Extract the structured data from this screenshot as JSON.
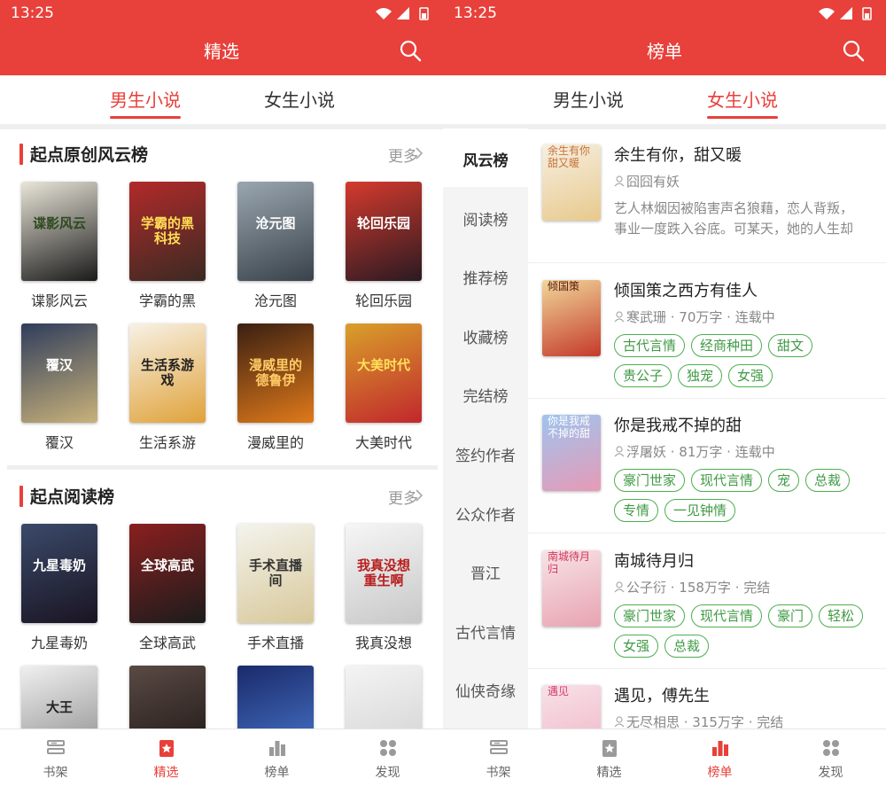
{
  "status": {
    "time": "13:25"
  },
  "left": {
    "title": "精选",
    "tabs": [
      "男生小说",
      "女生小说"
    ],
    "active_tab": 0,
    "sections": [
      {
        "title": "起点原创风云榜",
        "more": "更多",
        "books": [
          {
            "name": "谍影风云",
            "cover_text": "谍影风云",
            "colors": [
              "#e9e5d8",
              "#1a1a1a"
            ],
            "text_color": "#2d4a1f"
          },
          {
            "name": "学霸的黑",
            "cover_text": "学霸的黑科技",
            "colors": [
              "#b22a2a",
              "#3a2a22"
            ],
            "text_color": "#ffdd55"
          },
          {
            "name": "沧元图",
            "cover_text": "沧元图",
            "colors": [
              "#9aa6b0",
              "#39424a"
            ],
            "text_color": "#ffffff"
          },
          {
            "name": "轮回乐园",
            "cover_text": "轮回乐园",
            "colors": [
              "#d53a2d",
              "#2a1a22"
            ],
            "text_color": "#ffffff"
          }
        ]
      },
      {
        "title": "起点阅读榜",
        "more": "更多",
        "books": [
          {
            "name": "九星毒奶",
            "cover_text": "九星毒奶",
            "colors": [
              "#3a4a6a",
              "#1a1422"
            ],
            "text_color": "#ffffff"
          },
          {
            "name": "全球高武",
            "cover_text": "全球高武",
            "colors": [
              "#8a1f1f",
              "#1c1c1c"
            ],
            "text_color": "#ffffff"
          },
          {
            "name": "手术直播",
            "cover_text": "手术直播间",
            "colors": [
              "#f4f4ee",
              "#d8c89a"
            ],
            "text_color": "#333333"
          },
          {
            "name": "我真没想",
            "cover_text": "我真没想重生啊",
            "colors": [
              "#f6f6f6",
              "#c8c8c8"
            ],
            "text_color": "#b81d1d"
          }
        ]
      }
    ],
    "grid2_books": [
      {
        "name": "覆汉",
        "cover_text": "覆汉",
        "colors": [
          "#2f3d5c",
          "#c9b27a"
        ],
        "text_color": "#ffffff"
      },
      {
        "name": "生活系游",
        "cover_text": "生活系游戏",
        "colors": [
          "#f7f2e6",
          "#e0a23a"
        ],
        "text_color": "#222222"
      },
      {
        "name": "漫威里的",
        "cover_text": "漫威里的德鲁伊",
        "colors": [
          "#3a1f12",
          "#e07a1a"
        ],
        "text_color": "#ffcc66"
      },
      {
        "name": "大美时代",
        "cover_text": "大美时代",
        "colors": [
          "#d9a02a",
          "#c1272d"
        ],
        "text_color": "#ffe05a"
      }
    ],
    "partial_books": [
      {
        "cover_text": "大王",
        "colors": [
          "#f0f0f0",
          "#888888"
        ],
        "text_color": "#222222"
      },
      {
        "cover_text": "",
        "colors": [
          "#5a4a44",
          "#1a1414"
        ],
        "text_color": "#ffffff"
      },
      {
        "cover_text": "",
        "colors": [
          "#1a2a6a",
          "#4a7ad0"
        ],
        "text_color": "#ffffff"
      },
      {
        "cover_text": "",
        "colors": [
          "#f4f4f4",
          "#d0d0d0"
        ],
        "text_color": "#333333"
      }
    ]
  },
  "right": {
    "title": "榜单",
    "tabs": [
      "男生小说",
      "女生小说"
    ],
    "active_tab": 1,
    "rank_categories": [
      "风云榜",
      "阅读榜",
      "推荐榜",
      "收藏榜",
      "完结榜",
      "签约作者",
      "公众作者",
      "晋江",
      "古代言情",
      "仙侠奇缘"
    ],
    "active_category": 0,
    "books": [
      {
        "title": "余生有你，甜又暖",
        "meta": "囧囧有妖",
        "desc": [
          "艺人林烟因被陷害声名狼藉，恋人背叛，",
          "事业一度跌入谷底。可某天，她的人生却"
        ],
        "tags": [],
        "cover_text": "余生有你甜又暖",
        "colors": [
          "#f6efe2",
          "#e8c98c"
        ],
        "text_color": "#c7743a"
      },
      {
        "title": "倾国策之西方有佳人",
        "meta": "寒武珊 · 70万字 · 连载中",
        "desc": [],
        "tags": [
          [
            "古代言情",
            "经商种田",
            "甜文"
          ],
          [
            "贵公子",
            "独宠",
            "女强"
          ]
        ],
        "cover_text": "倾国策",
        "colors": [
          "#f1d79a",
          "#c43a2a"
        ],
        "text_color": "#5a1a10"
      },
      {
        "title": "你是我戒不掉的甜",
        "meta": "浮屠妖 · 81万字 · 连载中",
        "desc": [],
        "tags": [
          [
            "豪门世家",
            "现代言情",
            "宠",
            "总裁"
          ],
          [
            "专情",
            "一见钟情"
          ]
        ],
        "cover_text": "你是我戒不掉的甜",
        "colors": [
          "#9ec4ef",
          "#e79ab6"
        ],
        "text_color": "#ffffff"
      },
      {
        "title": "南城待月归",
        "meta": "公子衍 · 158万字 · 完结",
        "desc": [],
        "tags": [
          [
            "豪门世家",
            "现代言情",
            "豪门",
            "轻松"
          ],
          [
            "女强",
            "总裁"
          ]
        ],
        "cover_text": "南城待月归",
        "colors": [
          "#f7e3e6",
          "#e8a3b2"
        ],
        "text_color": "#d13a5a"
      },
      {
        "title": "遇见，傅先生",
        "meta": "无尽相思 · 315万字 · 完结",
        "desc": [],
        "tags": [
          [
            "",
            "",
            "",
            ""
          ]
        ],
        "cover_text": "遇见",
        "colors": [
          "#f7e1e8",
          "#f0b4c6"
        ],
        "text_color": "#d6406a"
      }
    ]
  },
  "bottom_nav": {
    "left": [
      "书架",
      "精选",
      "榜单",
      "发现"
    ],
    "left_active": 1,
    "right": [
      "书架",
      "精选",
      "榜单",
      "发现"
    ],
    "right_active": 2
  }
}
